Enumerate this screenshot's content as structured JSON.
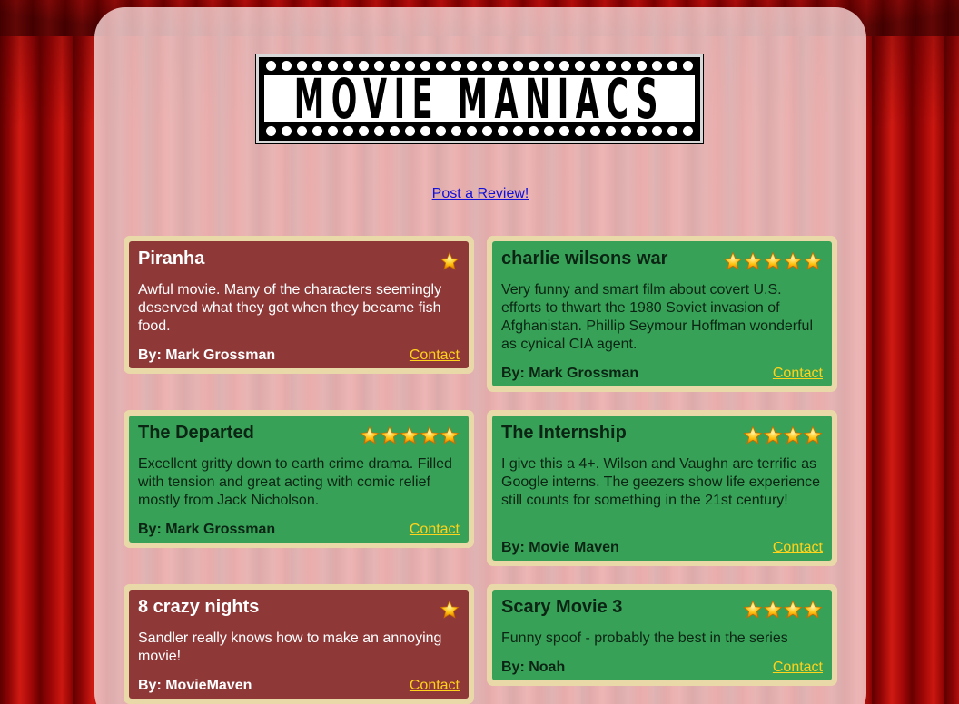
{
  "brand": {
    "logo_text": "MOVIE MANIACS"
  },
  "header": {
    "post_review_link": "Post a Review!"
  },
  "colors": {
    "negative_card": "#8f3838",
    "positive_card": "#37a257",
    "card_border": "#ead9a8",
    "contact_link": "#ffd21c",
    "star": "#ffc20e"
  },
  "reviews": [
    {
      "title": "Piranha",
      "stars": 1,
      "body": "Awful movie. Many of the characters seemingly deserved what they got when they became fish food.",
      "author": "By: Mark Grossman",
      "contact": "Contact",
      "tone": "bad"
    },
    {
      "title": "charlie wilsons war",
      "stars": 5,
      "body": "Very funny and smart film about covert U.S. efforts to thwart the 1980 Soviet invasion of Afghanistan. Phillip Seymour Hoffman wonderful as cynical CIA agent.",
      "author": "By: Mark Grossman",
      "contact": "Contact",
      "tone": "good"
    },
    {
      "title": "The Departed",
      "stars": 5,
      "body": "Excellent gritty down to earth crime drama. Filled with tension and great acting with comic relief mostly from Jack Nicholson.",
      "author": "By: Mark Grossman",
      "contact": "Contact",
      "tone": "good"
    },
    {
      "title": "The Internship",
      "stars": 4,
      "body": "I give this a 4+. Wilson and Vaughn are terrific as Google interns. The geezers show life experience still counts for something in the 21st century!",
      "author": "By: Movie Maven",
      "contact": "Contact",
      "tone": "good"
    },
    {
      "title": "8 crazy nights",
      "stars": 1,
      "body": "Sandler really knows how to make an annoying movie!",
      "author": "By: MovieMaven",
      "contact": "Contact",
      "tone": "bad"
    },
    {
      "title": "Scary Movie 3",
      "stars": 4,
      "body": "Funny spoof - probably the best in the series",
      "author": "By: Noah",
      "contact": "Contact",
      "tone": "good"
    }
  ]
}
